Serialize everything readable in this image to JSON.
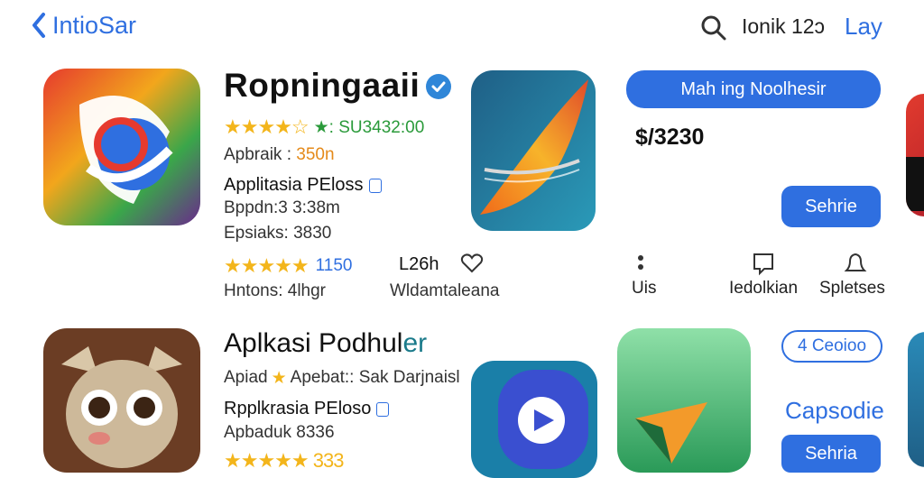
{
  "header": {
    "back_label": "IntioSar",
    "search_text": "Ionik 12ɔ",
    "link_label": "Lay"
  },
  "app1": {
    "title": "Ropningaaii",
    "rating_stars": "★★★★☆",
    "rating_extra": "★: SU3432:00",
    "line1_label": "Apbraik :",
    "line1_value": "350n",
    "category": "Applitasia PEloss",
    "line2": "Bppdn:3 3:38m",
    "line3": "Epsiaks: 3830",
    "review_stars": "★★★★★",
    "review_count": "1150",
    "stat_label": "L26h",
    "line4": "Hntons: 4lhgr",
    "line5": "Wldamtaleana"
  },
  "offer": {
    "cta_label": "Mah ing Noolhesir",
    "price": "$/3230",
    "secondary_label": "Sehrie"
  },
  "actions": [
    {
      "label": "Uis"
    },
    {
      "label": "Iedolkian"
    },
    {
      "label": "Spletses"
    }
  ],
  "section2": {
    "title_a": "Aplkasi Podhul",
    "title_b": "er",
    "subtitle_a": "Apiad",
    "subtitle_b": "Apebat:: Sak Darjnaisl",
    "category": "Rpplkrasia PEloso",
    "line2": "Apbaduk 8336",
    "stars": "★★★★★ 333"
  },
  "side2": {
    "outline_label": "4 Ceoioo",
    "heading": "Capsodie",
    "button_label": "Sehria"
  },
  "colors": {
    "accent": "#2f6fe0",
    "star": "#f3b51b",
    "green": "#2a9a3a"
  }
}
